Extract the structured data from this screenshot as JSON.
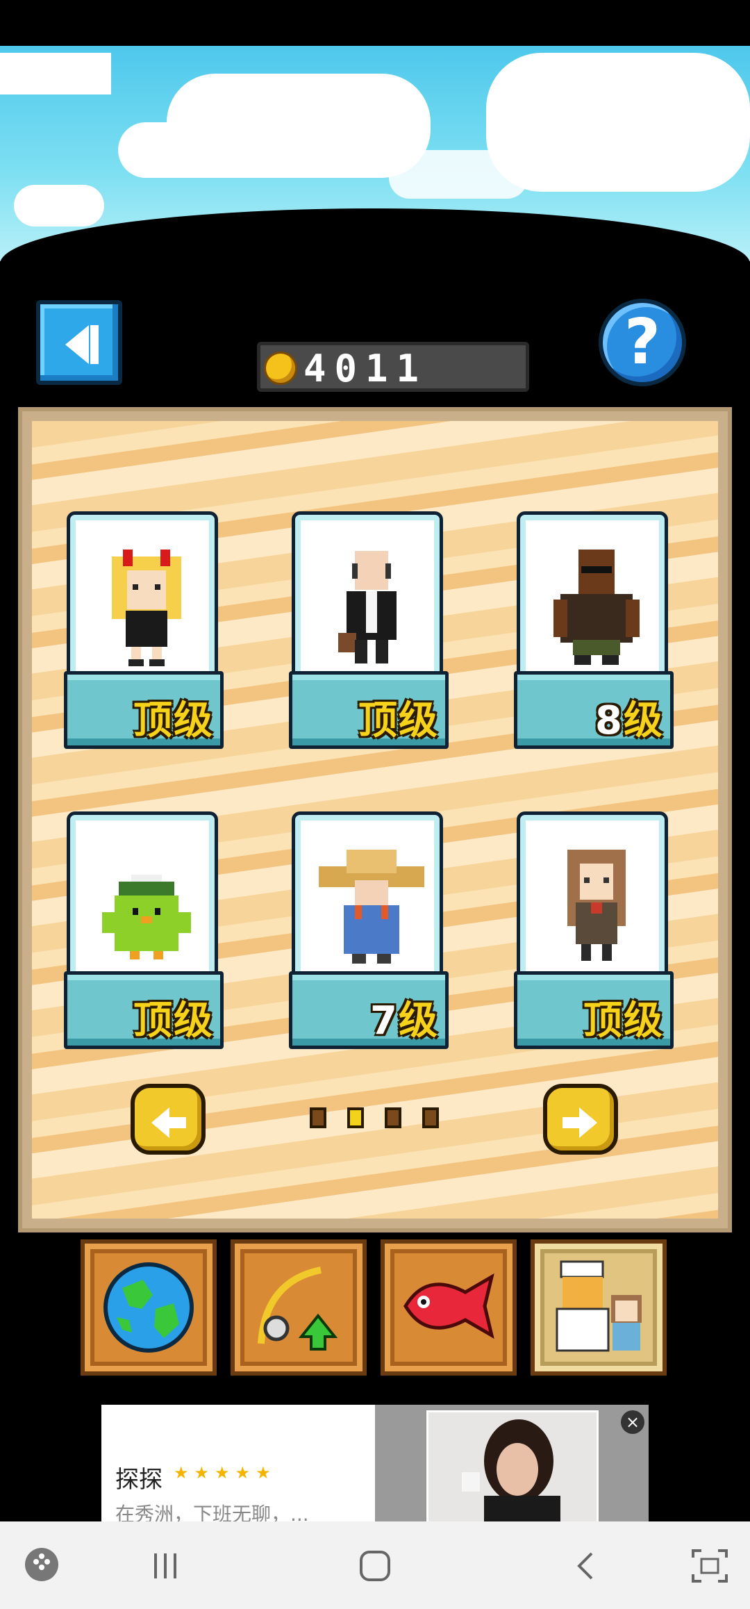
{
  "coins": "4011",
  "help_label": "?",
  "cards": [
    {
      "character": "horned-girl",
      "level_num": "",
      "level_text": "顶级"
    },
    {
      "character": "bald-businessman",
      "level_num": "",
      "level_text": "顶级"
    },
    {
      "character": "bearded-brute",
      "level_num": "8",
      "level_text": "级"
    },
    {
      "character": "green-bird",
      "level_num": "",
      "level_text": "顶级"
    },
    {
      "character": "straw-hat-granny",
      "level_num": "7",
      "level_text": "级"
    },
    {
      "character": "brown-haired-girl",
      "level_num": "",
      "level_text": "顶级"
    }
  ],
  "pager": {
    "pages": 4,
    "current": 2
  },
  "tabs": [
    {
      "icon": "globe-icon"
    },
    {
      "icon": "fishing-rod-upgrade-icon"
    },
    {
      "icon": "red-fish-icon"
    },
    {
      "icon": "characters-icon",
      "active": true
    }
  ],
  "ad": {
    "title": "探探",
    "stars": "★★★★★",
    "description": "在秀洲，下班无聊，...",
    "close": "×"
  }
}
